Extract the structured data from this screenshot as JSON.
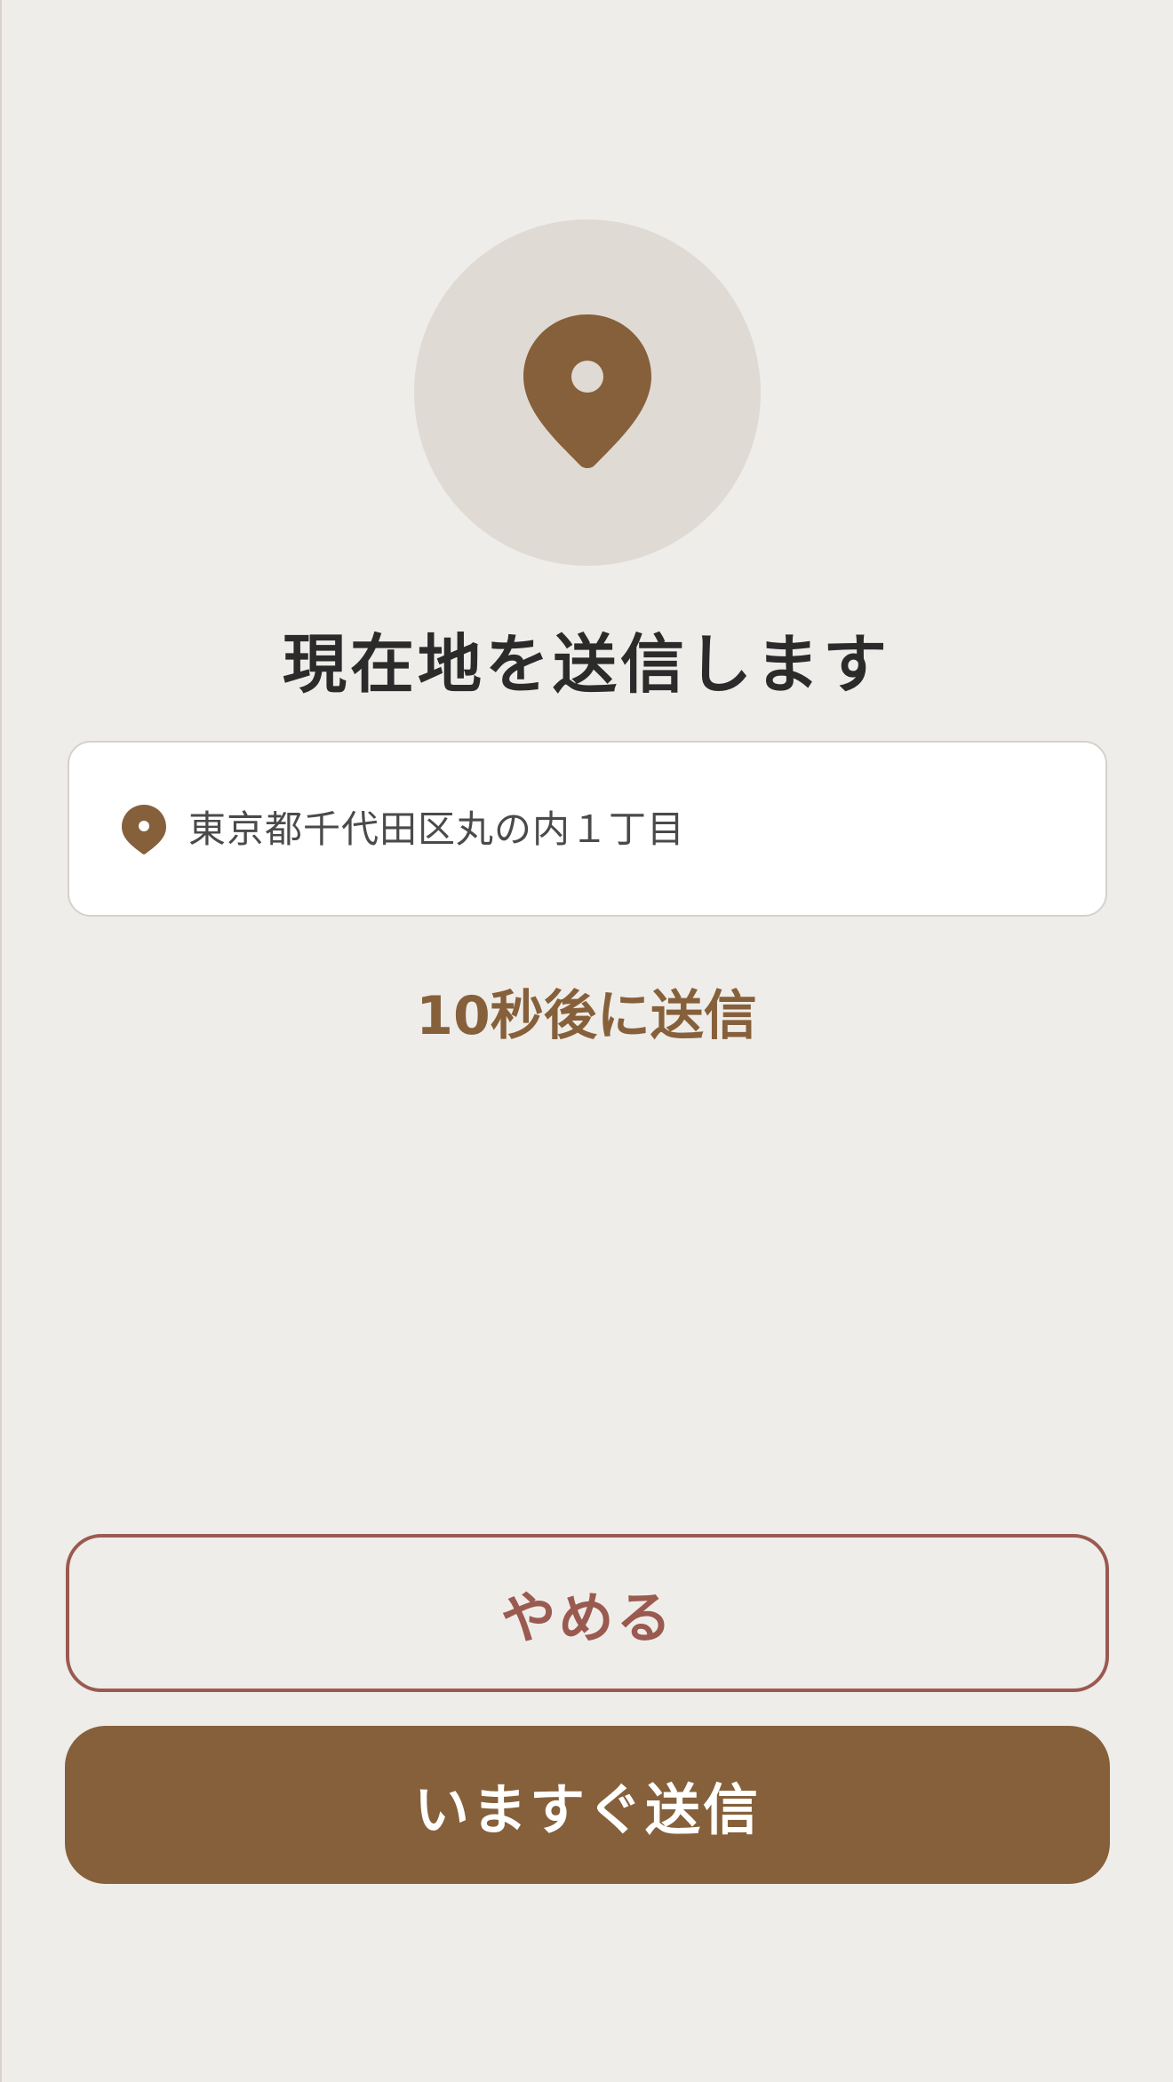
{
  "screen": {
    "title": "現在地を送信します",
    "hero_icon": "location-pin-icon",
    "address": {
      "icon": "location-pin-icon",
      "text": "東京都千代田区丸の内１丁目"
    },
    "countdown": "10秒後に送信"
  },
  "actions": {
    "cancel_label": "やめる",
    "send_now_label": "いますぐ送信"
  },
  "colors": {
    "background": "#efedea",
    "accent": "#86603a",
    "cancel": "#9a5a50",
    "title_text": "#2b2b2b",
    "hero_circle": "#e0dad4"
  }
}
